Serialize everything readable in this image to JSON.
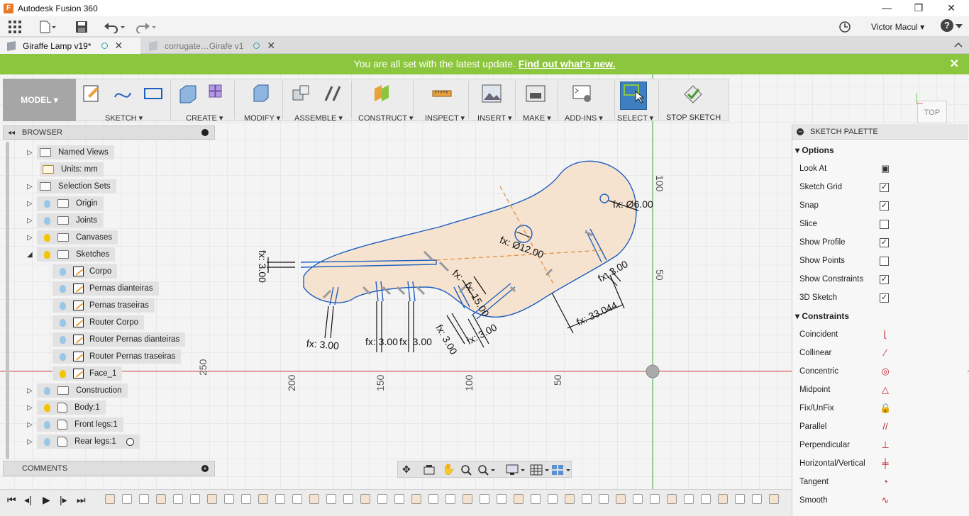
{
  "window": {
    "title": "Autodesk Fusion 360",
    "app_icon": "F",
    "minimize": "—",
    "restore": "❐",
    "close": "✕"
  },
  "quick_access": {
    "user": "Victor Macul ▾",
    "help": "?"
  },
  "tabs": [
    {
      "label": "Giraffe Lamp v19*",
      "active": true
    },
    {
      "label": "corrugate…Girafe v1",
      "active": false
    }
  ],
  "banner": {
    "text": "You are all set with the latest update.",
    "link": "Find out what's new."
  },
  "toolbar": {
    "model": "MODEL ▾",
    "groups": [
      "SKETCH ▾",
      "CREATE ▾",
      "MODIFY ▾",
      "ASSEMBLE ▾",
      "CONSTRUCT ▾",
      "INSPECT ▾",
      "INSERT ▾",
      "MAKE ▾",
      "ADD-INS ▾",
      "SELECT ▾",
      "STOP SKETCH"
    ]
  },
  "browser": {
    "title": "BROWSER",
    "items": [
      {
        "label": "Named Views",
        "type": "folder"
      },
      {
        "label": "Units: mm",
        "type": "units"
      },
      {
        "label": "Selection Sets",
        "type": "folder"
      },
      {
        "label": "Origin",
        "type": "folder"
      },
      {
        "label": "Joints",
        "type": "folder"
      },
      {
        "label": "Canvases",
        "type": "folder"
      },
      {
        "label": "Sketches",
        "type": "folder"
      },
      {
        "label": "Corpo",
        "type": "sketch"
      },
      {
        "label": "Pernas dianteiras",
        "type": "sketch"
      },
      {
        "label": "Pernas traseiras",
        "type": "sketch"
      },
      {
        "label": "Router Corpo",
        "type": "sketch"
      },
      {
        "label": "Router Pernas dianteiras",
        "type": "sketch"
      },
      {
        "label": "Router Pernas traseiras",
        "type": "sketch"
      },
      {
        "label": "Face_1",
        "type": "sketch"
      },
      {
        "label": "Construction",
        "type": "folder"
      },
      {
        "label": "Body:1",
        "type": "body"
      },
      {
        "label": "Front legs:1",
        "type": "body"
      },
      {
        "label": "Rear legs:1",
        "type": "body"
      }
    ]
  },
  "comments": {
    "title": "COMMENTS"
  },
  "viewcube": {
    "label": "TOP"
  },
  "canvas": {
    "axis_ticks_x": [
      "250",
      "200",
      "150",
      "100",
      "50"
    ],
    "axis_ticks_y": [
      "100",
      "50"
    ],
    "dimensions": [
      "fx: Ø6.00",
      "fx: Ø12.00",
      "fx: 3.00",
      "fx: 3.00",
      "fx: 3.00",
      "fx: 3.00",
      "fx: 3.00",
      "fx: 3.00",
      "fx: 33.044",
      "fx: 15.00",
      "fx: 3.00",
      "fx:"
    ]
  },
  "palette": {
    "title": "SKETCH PALETTE",
    "options_header": "Options",
    "options": [
      {
        "label": "Look At",
        "checked": null
      },
      {
        "label": "Sketch Grid",
        "checked": true
      },
      {
        "label": "Snap",
        "checked": true
      },
      {
        "label": "Slice",
        "checked": false
      },
      {
        "label": "Show Profile",
        "checked": true
      },
      {
        "label": "Show Points",
        "checked": false
      },
      {
        "label": "Show Constraints",
        "checked": true
      },
      {
        "label": "3D Sketch",
        "checked": true
      }
    ],
    "constraints_header": "Constraints",
    "constraints": [
      {
        "label": "Coincident",
        "icon": "coincident-icon"
      },
      {
        "label": "Collinear",
        "icon": "collinear-icon"
      },
      {
        "label": "Concentric",
        "icon": "concentric-icon"
      },
      {
        "label": "Midpoint",
        "icon": "midpoint-icon"
      },
      {
        "label": "Fix/UnFix",
        "icon": "lock-icon"
      },
      {
        "label": "Parallel",
        "icon": "parallel-icon"
      },
      {
        "label": "Perpendicular",
        "icon": "perpendicular-icon"
      },
      {
        "label": "Horizontal/Vertical",
        "icon": "horizontal-vertical-icon"
      },
      {
        "label": "Tangent",
        "icon": "tangent-icon"
      },
      {
        "label": "Smooth",
        "icon": "smooth-icon"
      }
    ]
  },
  "colors": {
    "banner": "#8cc63e",
    "sketch_line": "#1f5fbf",
    "profile_fill": "#f5e3cf",
    "constraint_red": "#c0272d"
  }
}
